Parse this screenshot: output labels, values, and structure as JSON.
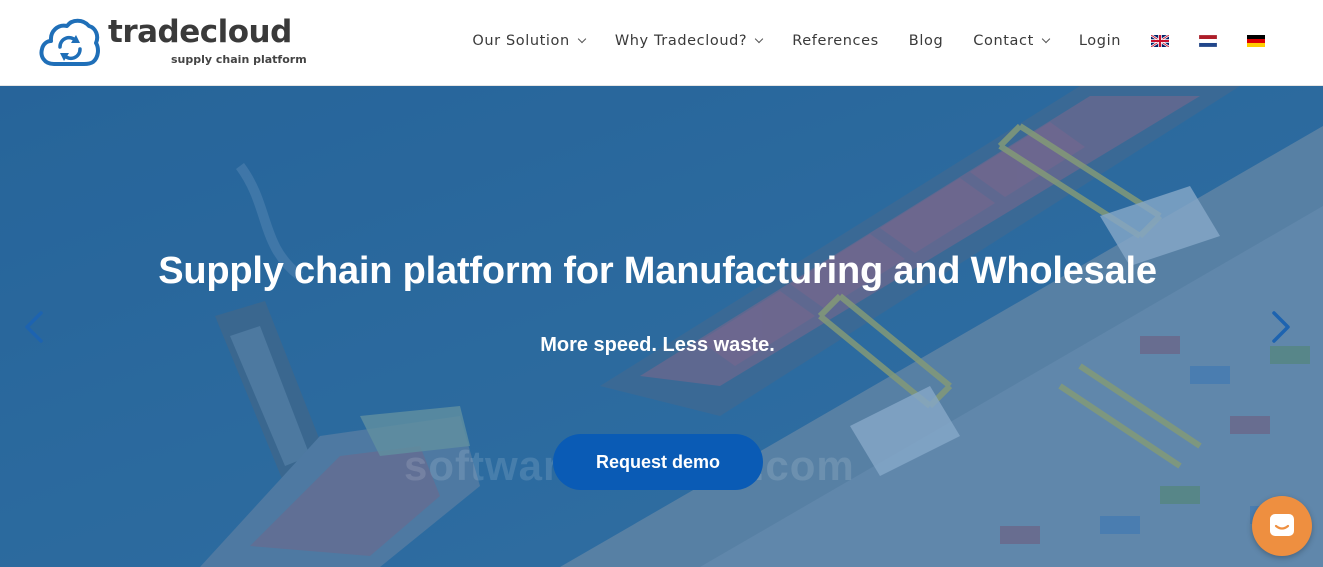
{
  "brand": {
    "name": "tradecloud",
    "tagline": "supply chain platform",
    "color": "#1f6fb8"
  },
  "nav": {
    "items": [
      {
        "label": "Our Solution",
        "dropdown": true
      },
      {
        "label": "Why Tradecloud?",
        "dropdown": true
      },
      {
        "label": "References",
        "dropdown": false
      },
      {
        "label": "Blog",
        "dropdown": false
      },
      {
        "label": "Contact",
        "dropdown": true
      },
      {
        "label": "Login",
        "dropdown": false
      }
    ],
    "languages": [
      "english-flag",
      "dutch-flag",
      "german-flag"
    ]
  },
  "hero": {
    "headline": "Supply chain platform for Manufacturing and Wholesale",
    "subline": "More speed. Less waste.",
    "cta_label": "Request demo",
    "watermark": "softwaresuggest.com",
    "prev_icon": "chevron-left-icon",
    "next_icon": "chevron-right-icon"
  },
  "chat": {
    "icon": "chat-bubble-icon",
    "color": "#ee8f40"
  }
}
